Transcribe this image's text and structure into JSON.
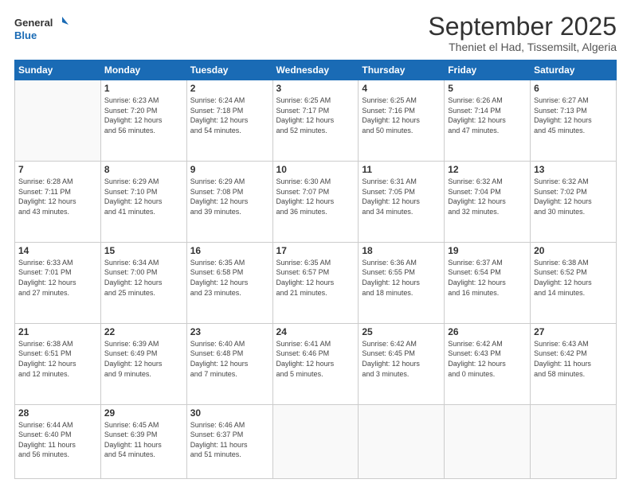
{
  "logo": {
    "general": "General",
    "blue": "Blue"
  },
  "header": {
    "month": "September 2025",
    "location": "Theniet el Had, Tissemsilt, Algeria"
  },
  "weekdays": [
    "Sunday",
    "Monday",
    "Tuesday",
    "Wednesday",
    "Thursday",
    "Friday",
    "Saturday"
  ],
  "weeks": [
    [
      {
        "day": "",
        "info": ""
      },
      {
        "day": "1",
        "info": "Sunrise: 6:23 AM\nSunset: 7:20 PM\nDaylight: 12 hours\nand 56 minutes."
      },
      {
        "day": "2",
        "info": "Sunrise: 6:24 AM\nSunset: 7:18 PM\nDaylight: 12 hours\nand 54 minutes."
      },
      {
        "day": "3",
        "info": "Sunrise: 6:25 AM\nSunset: 7:17 PM\nDaylight: 12 hours\nand 52 minutes."
      },
      {
        "day": "4",
        "info": "Sunrise: 6:25 AM\nSunset: 7:16 PM\nDaylight: 12 hours\nand 50 minutes."
      },
      {
        "day": "5",
        "info": "Sunrise: 6:26 AM\nSunset: 7:14 PM\nDaylight: 12 hours\nand 47 minutes."
      },
      {
        "day": "6",
        "info": "Sunrise: 6:27 AM\nSunset: 7:13 PM\nDaylight: 12 hours\nand 45 minutes."
      }
    ],
    [
      {
        "day": "7",
        "info": "Sunrise: 6:28 AM\nSunset: 7:11 PM\nDaylight: 12 hours\nand 43 minutes."
      },
      {
        "day": "8",
        "info": "Sunrise: 6:29 AM\nSunset: 7:10 PM\nDaylight: 12 hours\nand 41 minutes."
      },
      {
        "day": "9",
        "info": "Sunrise: 6:29 AM\nSunset: 7:08 PM\nDaylight: 12 hours\nand 39 minutes."
      },
      {
        "day": "10",
        "info": "Sunrise: 6:30 AM\nSunset: 7:07 PM\nDaylight: 12 hours\nand 36 minutes."
      },
      {
        "day": "11",
        "info": "Sunrise: 6:31 AM\nSunset: 7:05 PM\nDaylight: 12 hours\nand 34 minutes."
      },
      {
        "day": "12",
        "info": "Sunrise: 6:32 AM\nSunset: 7:04 PM\nDaylight: 12 hours\nand 32 minutes."
      },
      {
        "day": "13",
        "info": "Sunrise: 6:32 AM\nSunset: 7:02 PM\nDaylight: 12 hours\nand 30 minutes."
      }
    ],
    [
      {
        "day": "14",
        "info": "Sunrise: 6:33 AM\nSunset: 7:01 PM\nDaylight: 12 hours\nand 27 minutes."
      },
      {
        "day": "15",
        "info": "Sunrise: 6:34 AM\nSunset: 7:00 PM\nDaylight: 12 hours\nand 25 minutes."
      },
      {
        "day": "16",
        "info": "Sunrise: 6:35 AM\nSunset: 6:58 PM\nDaylight: 12 hours\nand 23 minutes."
      },
      {
        "day": "17",
        "info": "Sunrise: 6:35 AM\nSunset: 6:57 PM\nDaylight: 12 hours\nand 21 minutes."
      },
      {
        "day": "18",
        "info": "Sunrise: 6:36 AM\nSunset: 6:55 PM\nDaylight: 12 hours\nand 18 minutes."
      },
      {
        "day": "19",
        "info": "Sunrise: 6:37 AM\nSunset: 6:54 PM\nDaylight: 12 hours\nand 16 minutes."
      },
      {
        "day": "20",
        "info": "Sunrise: 6:38 AM\nSunset: 6:52 PM\nDaylight: 12 hours\nand 14 minutes."
      }
    ],
    [
      {
        "day": "21",
        "info": "Sunrise: 6:38 AM\nSunset: 6:51 PM\nDaylight: 12 hours\nand 12 minutes."
      },
      {
        "day": "22",
        "info": "Sunrise: 6:39 AM\nSunset: 6:49 PM\nDaylight: 12 hours\nand 9 minutes."
      },
      {
        "day": "23",
        "info": "Sunrise: 6:40 AM\nSunset: 6:48 PM\nDaylight: 12 hours\nand 7 minutes."
      },
      {
        "day": "24",
        "info": "Sunrise: 6:41 AM\nSunset: 6:46 PM\nDaylight: 12 hours\nand 5 minutes."
      },
      {
        "day": "25",
        "info": "Sunrise: 6:42 AM\nSunset: 6:45 PM\nDaylight: 12 hours\nand 3 minutes."
      },
      {
        "day": "26",
        "info": "Sunrise: 6:42 AM\nSunset: 6:43 PM\nDaylight: 12 hours\nand 0 minutes."
      },
      {
        "day": "27",
        "info": "Sunrise: 6:43 AM\nSunset: 6:42 PM\nDaylight: 11 hours\nand 58 minutes."
      }
    ],
    [
      {
        "day": "28",
        "info": "Sunrise: 6:44 AM\nSunset: 6:40 PM\nDaylight: 11 hours\nand 56 minutes."
      },
      {
        "day": "29",
        "info": "Sunrise: 6:45 AM\nSunset: 6:39 PM\nDaylight: 11 hours\nand 54 minutes."
      },
      {
        "day": "30",
        "info": "Sunrise: 6:46 AM\nSunset: 6:37 PM\nDaylight: 11 hours\nand 51 minutes."
      },
      {
        "day": "",
        "info": ""
      },
      {
        "day": "",
        "info": ""
      },
      {
        "day": "",
        "info": ""
      },
      {
        "day": "",
        "info": ""
      }
    ]
  ]
}
